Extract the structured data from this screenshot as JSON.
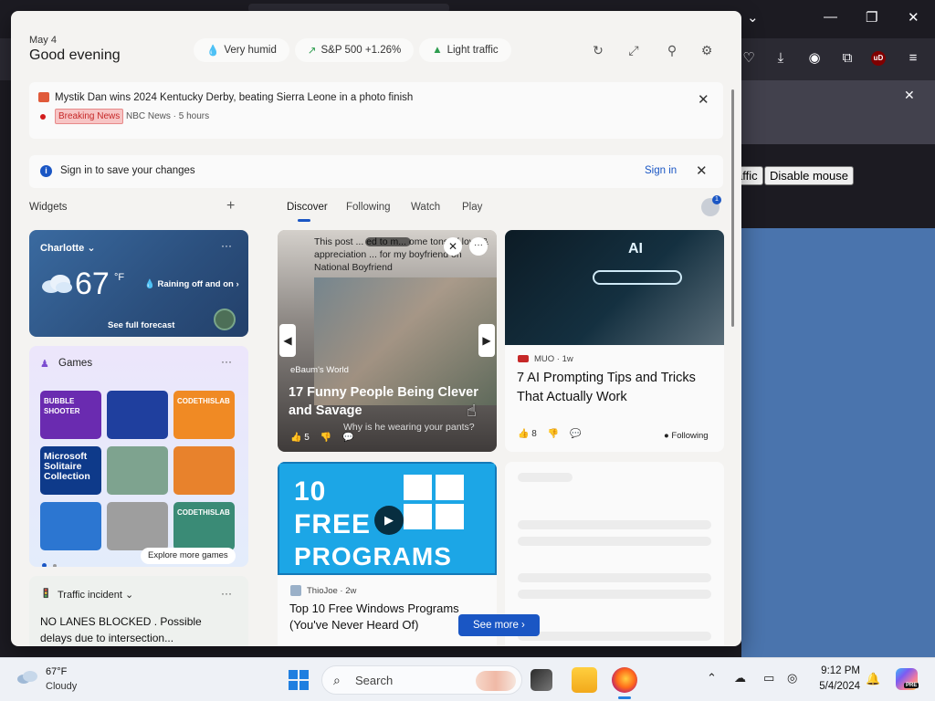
{
  "browser": {
    "buttons": [
      "affic",
      "Disable mouse"
    ]
  },
  "header": {
    "date": "May 4",
    "greeting": "Good evening",
    "pills": [
      {
        "icon": "water-drop-icon",
        "label": "Very humid"
      },
      {
        "icon": "stock-up-icon",
        "label": "S&P 500 +1.26%"
      },
      {
        "icon": "car-icon",
        "label": "Light traffic"
      }
    ]
  },
  "breaking": {
    "headline": "Mystik Dan wins 2024 Kentucky Derby, beating Sierra Leone in a photo finish",
    "badge": "Breaking News",
    "source": "NBC News · 5 hours"
  },
  "signin": {
    "text": "Sign in to save your changes",
    "link": "Sign in"
  },
  "widgets": {
    "label": "Widgets",
    "weather": {
      "city": "Charlotte",
      "temp": "67",
      "unit": "°F",
      "condition": "Raining off and on",
      "forecast_link": "See full forecast"
    },
    "games": {
      "label": "Games",
      "tiles": [
        {
          "label": "BUBBLE SHOOTER",
          "color": "#6a2bb0"
        },
        {
          "label": "",
          "color": "#1f3f9e"
        },
        {
          "label": "CODETHISLAB",
          "color": "#f08a24"
        },
        {
          "label": "Microsoft Solitaire Collection",
          "color": "#0e3a8a"
        },
        {
          "label": "",
          "color": "#7ea38f"
        },
        {
          "label": "",
          "color": "#e8822c"
        },
        {
          "label": "",
          "color": "#2c76d1"
        },
        {
          "label": "",
          "color": "#9e9e9e"
        },
        {
          "label": "CODETHISLAB",
          "color": "#3a8b76"
        }
      ],
      "explore": "Explore more games"
    },
    "traffic": {
      "label": "Traffic incident",
      "text": "NO LANES BLOCKED . Possible delays due to intersection..."
    }
  },
  "feed": {
    "tabs": [
      "Discover",
      "Following",
      "Watch",
      "Play"
    ],
    "avatar_badge": "1",
    "cards": [
      {
        "caption": "This post ... ed to m... ome tons of love & appreciation ... for my boyfriend on National Boyfriend",
        "source": "eBaum's World",
        "title": "17 Funny People Being Clever and Savage",
        "subtitle": "Why is he wearing your pants?",
        "likes": "5"
      },
      {
        "source": "MUO · 1w",
        "title": "7 AI Prompting Tips and Tricks That Actually Work",
        "image_text": "AI",
        "likes": "8",
        "following": "Following"
      },
      {
        "image_lines": [
          "10",
          "FREE",
          "PROGRAMS"
        ],
        "source": "ThioJoe · 2w",
        "title": "Top 10 Free Windows Programs (You've Never Heard Of)"
      }
    ],
    "see_more": "See more"
  },
  "taskbar": {
    "temp": "67°F",
    "condition": "Cloudy",
    "search": "Search",
    "time": "9:12 PM",
    "date": "5/4/2024",
    "copilot_badge": "PRE"
  }
}
